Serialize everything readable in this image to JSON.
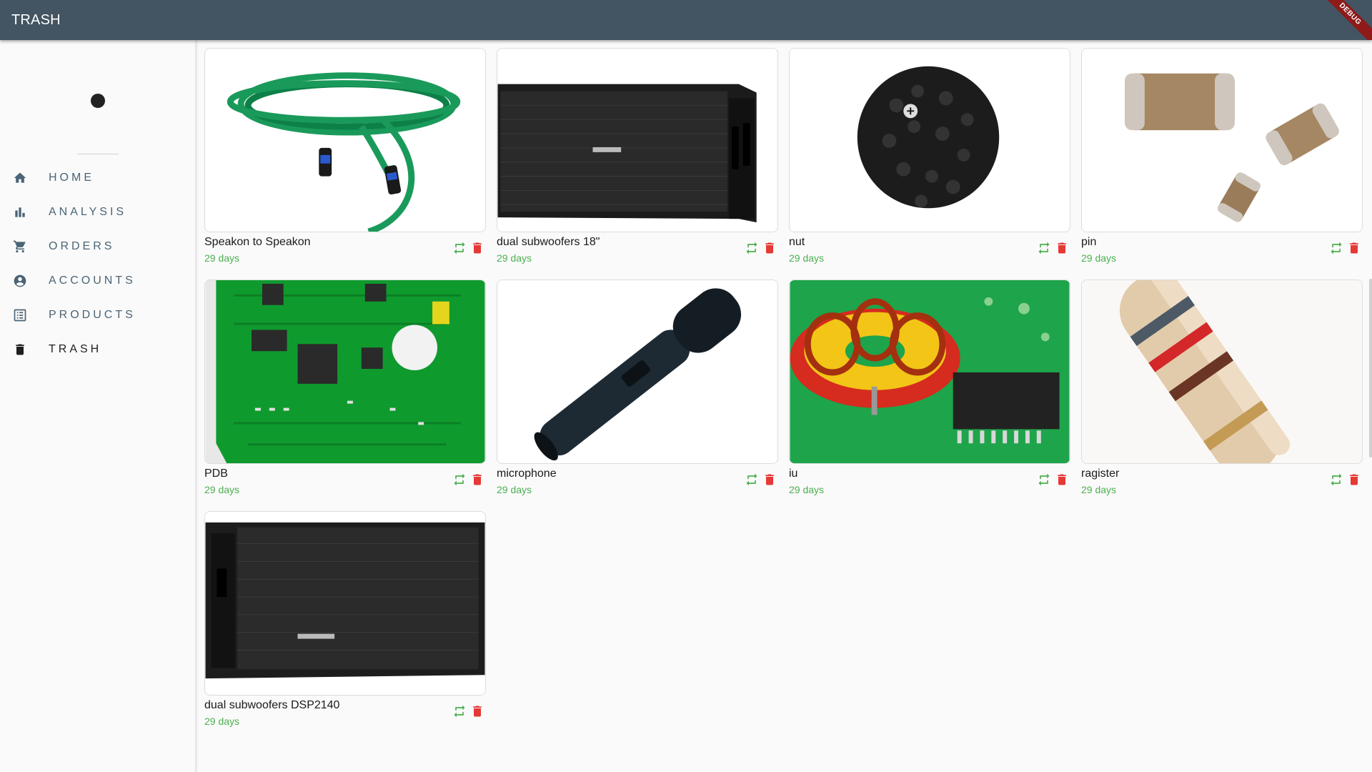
{
  "appbar": {
    "title": "TRASH",
    "debug_banner": "DEBUG"
  },
  "colors": {
    "appbar": "#435462",
    "restore": "#4caf50",
    "delete": "#e53935",
    "days": "#4caf50",
    "nav_text": "#4b6476"
  },
  "sidebar": {
    "items": [
      {
        "label": "HOME",
        "icon": "home-icon"
      },
      {
        "label": "ANALYSIS",
        "icon": "bar-chart-icon"
      },
      {
        "label": "ORDERS",
        "icon": "cart-icon"
      },
      {
        "label": "ACCOUNTS",
        "icon": "account-circle-icon"
      },
      {
        "label": "PRODUCTS",
        "icon": "list-icon"
      },
      {
        "label": "TRASH",
        "icon": "trash-icon",
        "active": true
      }
    ]
  },
  "items": [
    {
      "name": "Speakon to Speakon",
      "age": "29 days",
      "image": "green-cable-image"
    },
    {
      "name": "dual subwoofers 18\"",
      "age": "29 days",
      "image": "subwoofer-image"
    },
    {
      "name": "nut",
      "age": "29 days",
      "image": "black-screws-image"
    },
    {
      "name": "pin",
      "age": "29 days",
      "image": "smd-capacitors-image"
    },
    {
      "name": "PDB",
      "age": "29 days",
      "image": "green-pcb-image"
    },
    {
      "name": "microphone",
      "age": "29 days",
      "image": "microphone-image"
    },
    {
      "name": "iu",
      "age": "29 days",
      "image": "toroid-inductor-image"
    },
    {
      "name": "ragister",
      "age": "29 days",
      "image": "resistor-image"
    },
    {
      "name": "dual subwoofers DSP2140",
      "age": "29 days",
      "image": "subwoofer-dsp-image"
    }
  ]
}
